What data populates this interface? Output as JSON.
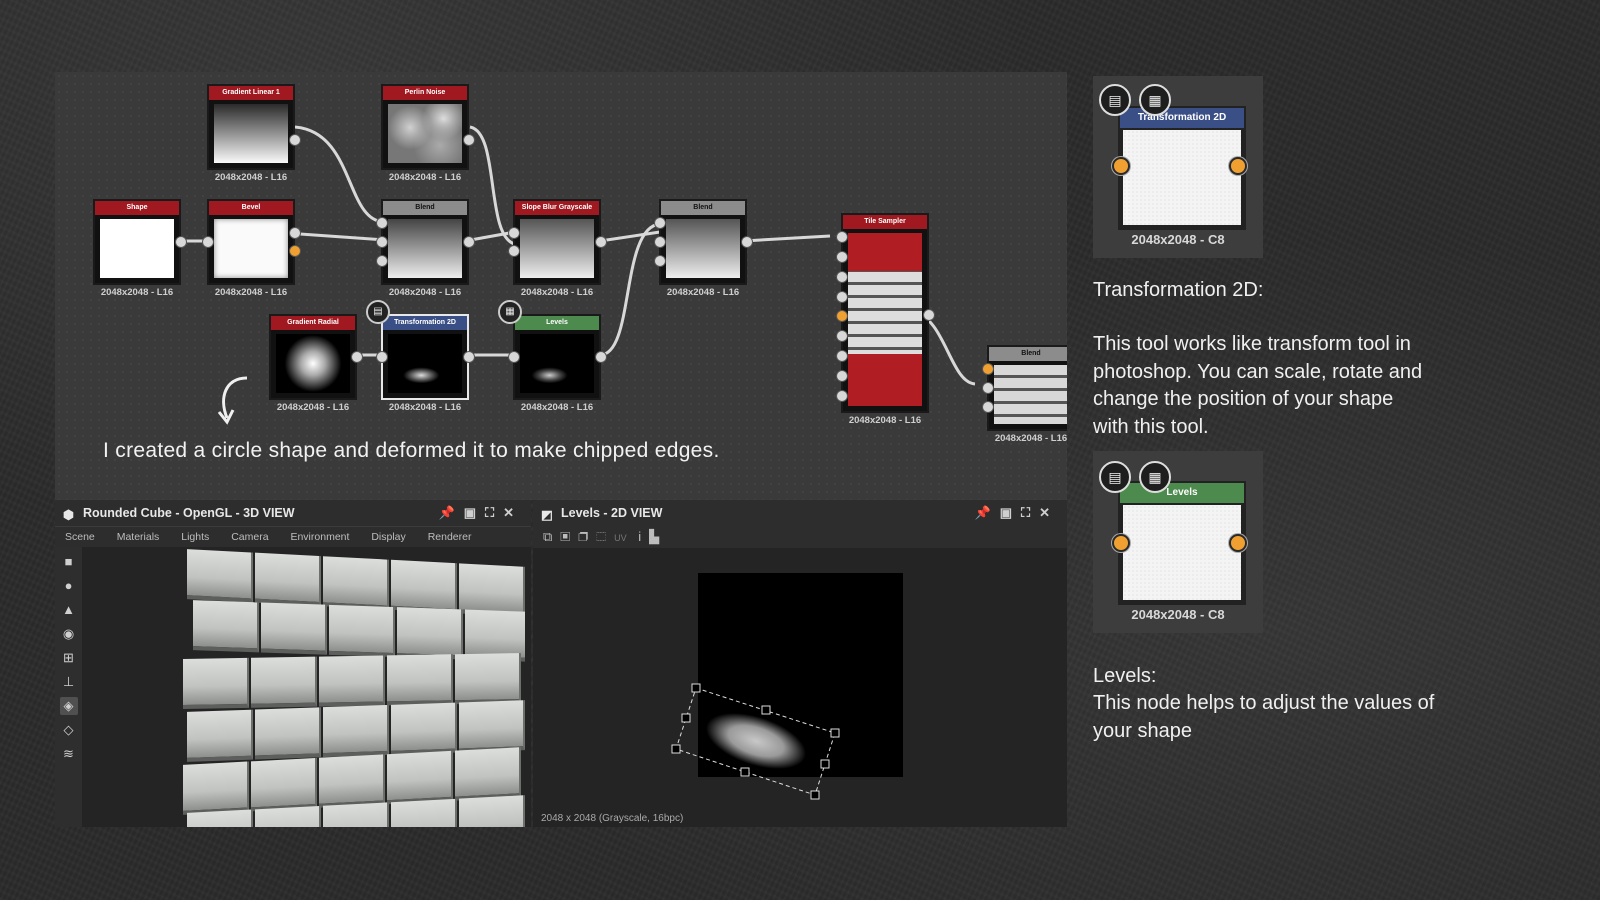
{
  "graph": {
    "nodes": {
      "gradient_linear": {
        "title": "Gradient Linear 1",
        "res": "2048x2048 - L16"
      },
      "perlin_noise": {
        "title": "Perlin Noise",
        "res": "2048x2048 - L16"
      },
      "shape": {
        "title": "Shape",
        "res": "2048x2048 - L16"
      },
      "bevel": {
        "title": "Bevel",
        "res": "2048x2048 - L16"
      },
      "blend1": {
        "title": "Blend",
        "res": "2048x2048 - L16"
      },
      "slope_blur": {
        "title": "Slope Blur Grayscale",
        "res": "2048x2048 - L16"
      },
      "blend2": {
        "title": "Blend",
        "res": "2048x2048 - L16"
      },
      "tile_sampler": {
        "title": "Tile Sampler",
        "res": "2048x2048 - L16"
      },
      "blend3": {
        "title": "Blend",
        "res": "2048x2048 - L16"
      },
      "gradient_radial": {
        "title": "Gradient Radial",
        "res": "2048x2048 - L16"
      },
      "transformation_2d": {
        "title": "Transformation 2D",
        "res": "2048x2048 - L16"
      },
      "levels": {
        "title": "Levels",
        "res": "2048x2048 - L16"
      }
    },
    "caption": "I created a circle shape and deformed it to make chipped edges."
  },
  "view3d": {
    "title": "Rounded Cube - OpenGL - 3D VIEW",
    "menu": [
      "Scene",
      "Materials",
      "Lights",
      "Camera",
      "Environment",
      "Display",
      "Renderer"
    ],
    "controls": "pin, float, maximize, close"
  },
  "view2d": {
    "title": "Levels - 2D VIEW",
    "uv_label": "UV",
    "status": "2048 x 2048 (Grayscale, 16bpc)"
  },
  "right": {
    "transform_card": {
      "header": "Transformation 2D",
      "res": "2048x2048 - C8"
    },
    "transform_heading": "Transformation 2D:",
    "transform_body": [
      "This tool works like transform tool in",
      "photoshop. You can scale, rotate and",
      "change the position of your shape",
      "with this tool."
    ],
    "levels_card": {
      "header": "Levels",
      "res": "2048x2048 - C8"
    },
    "levels_heading": "Levels:",
    "levels_body": [
      "This node helps to adjust the values of",
      "your shape"
    ]
  },
  "colors": {
    "node_red": "#a01820",
    "node_gray": "#8c8c8c",
    "node_blue": "#3a4f86",
    "node_green": "#4d8a4d",
    "port_orange": "#f0a030"
  }
}
